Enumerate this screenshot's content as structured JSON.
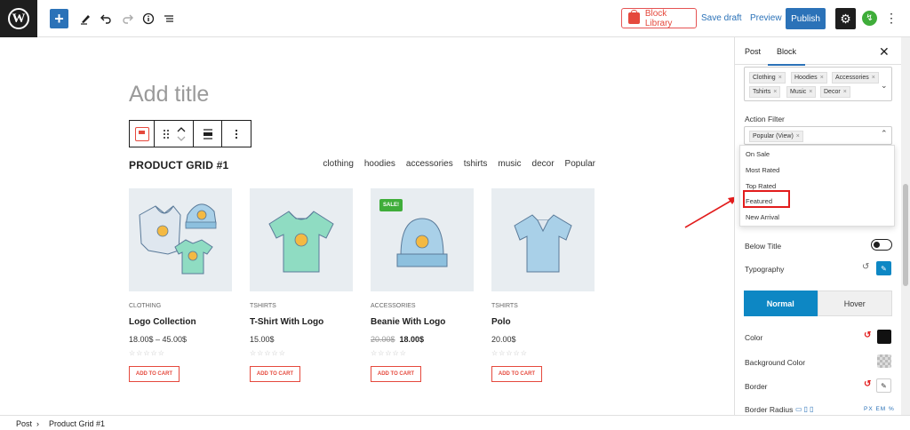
{
  "topbar": {
    "logo_letter": "W",
    "add_icon": "+",
    "block_library_label": "Block Library",
    "save_draft_label": "Save draft",
    "preview_label": "Preview",
    "publish_label": "Publish",
    "settings_icon": "⚙",
    "bolt_icon": "↯",
    "more_icon": "⋮"
  },
  "editor": {
    "title_placeholder": "Add title",
    "block_title": "PRODUCT GRID #1",
    "filter_tabs": [
      "clothing",
      "hoodies",
      "accessories",
      "tshirts",
      "music",
      "decor",
      "Popular"
    ],
    "products": [
      {
        "category": "CLOTHING",
        "name": "Logo Collection",
        "price": "18.00$ – 45.00$",
        "old_price": "",
        "new_price": "",
        "button": "ADD TO CART",
        "badge": ""
      },
      {
        "category": "TSHIRTS",
        "name": "T-Shirt With Logo",
        "price": "15.00$",
        "old_price": "",
        "new_price": "",
        "button": "ADD TO CART",
        "badge": ""
      },
      {
        "category": "ACCESSORIES",
        "name": "Beanie With Logo",
        "price": "",
        "old_price": "20.00$",
        "new_price": "18.00$",
        "button": "ADD TO CART",
        "badge": "SALE!"
      },
      {
        "category": "TSHIRTS",
        "name": "Polo",
        "price": "20.00$",
        "old_price": "",
        "new_price": "",
        "button": "ADD TO CART",
        "badge": ""
      }
    ],
    "stars": "☆☆☆☆☆"
  },
  "sidebar": {
    "tabs": {
      "post": "Post",
      "block": "Block"
    },
    "close_icon": "✕",
    "category_tags": [
      "Clothing",
      "Hoodies",
      "Accessories",
      "Tshirts",
      "Music",
      "Decor"
    ],
    "action_filter_label": "Action Filter",
    "action_filter_selected": "Popular (View)",
    "dropdown_options": [
      "On Sale",
      "Most Rated",
      "Top Rated",
      "Featured",
      "New Arrival"
    ],
    "below_title_label": "Below Title",
    "typography_label": "Typography",
    "normal_label": "Normal",
    "hover_label": "Hover",
    "color_label": "Color",
    "background_color_label": "Background Color",
    "border_label": "Border",
    "border_radius_label": "Border Radius",
    "units": "PX EM %",
    "accent_color": "#0d87c4"
  },
  "breadcrumb": {
    "root": "Post",
    "separator": "›",
    "current": "Product Grid #1"
  }
}
